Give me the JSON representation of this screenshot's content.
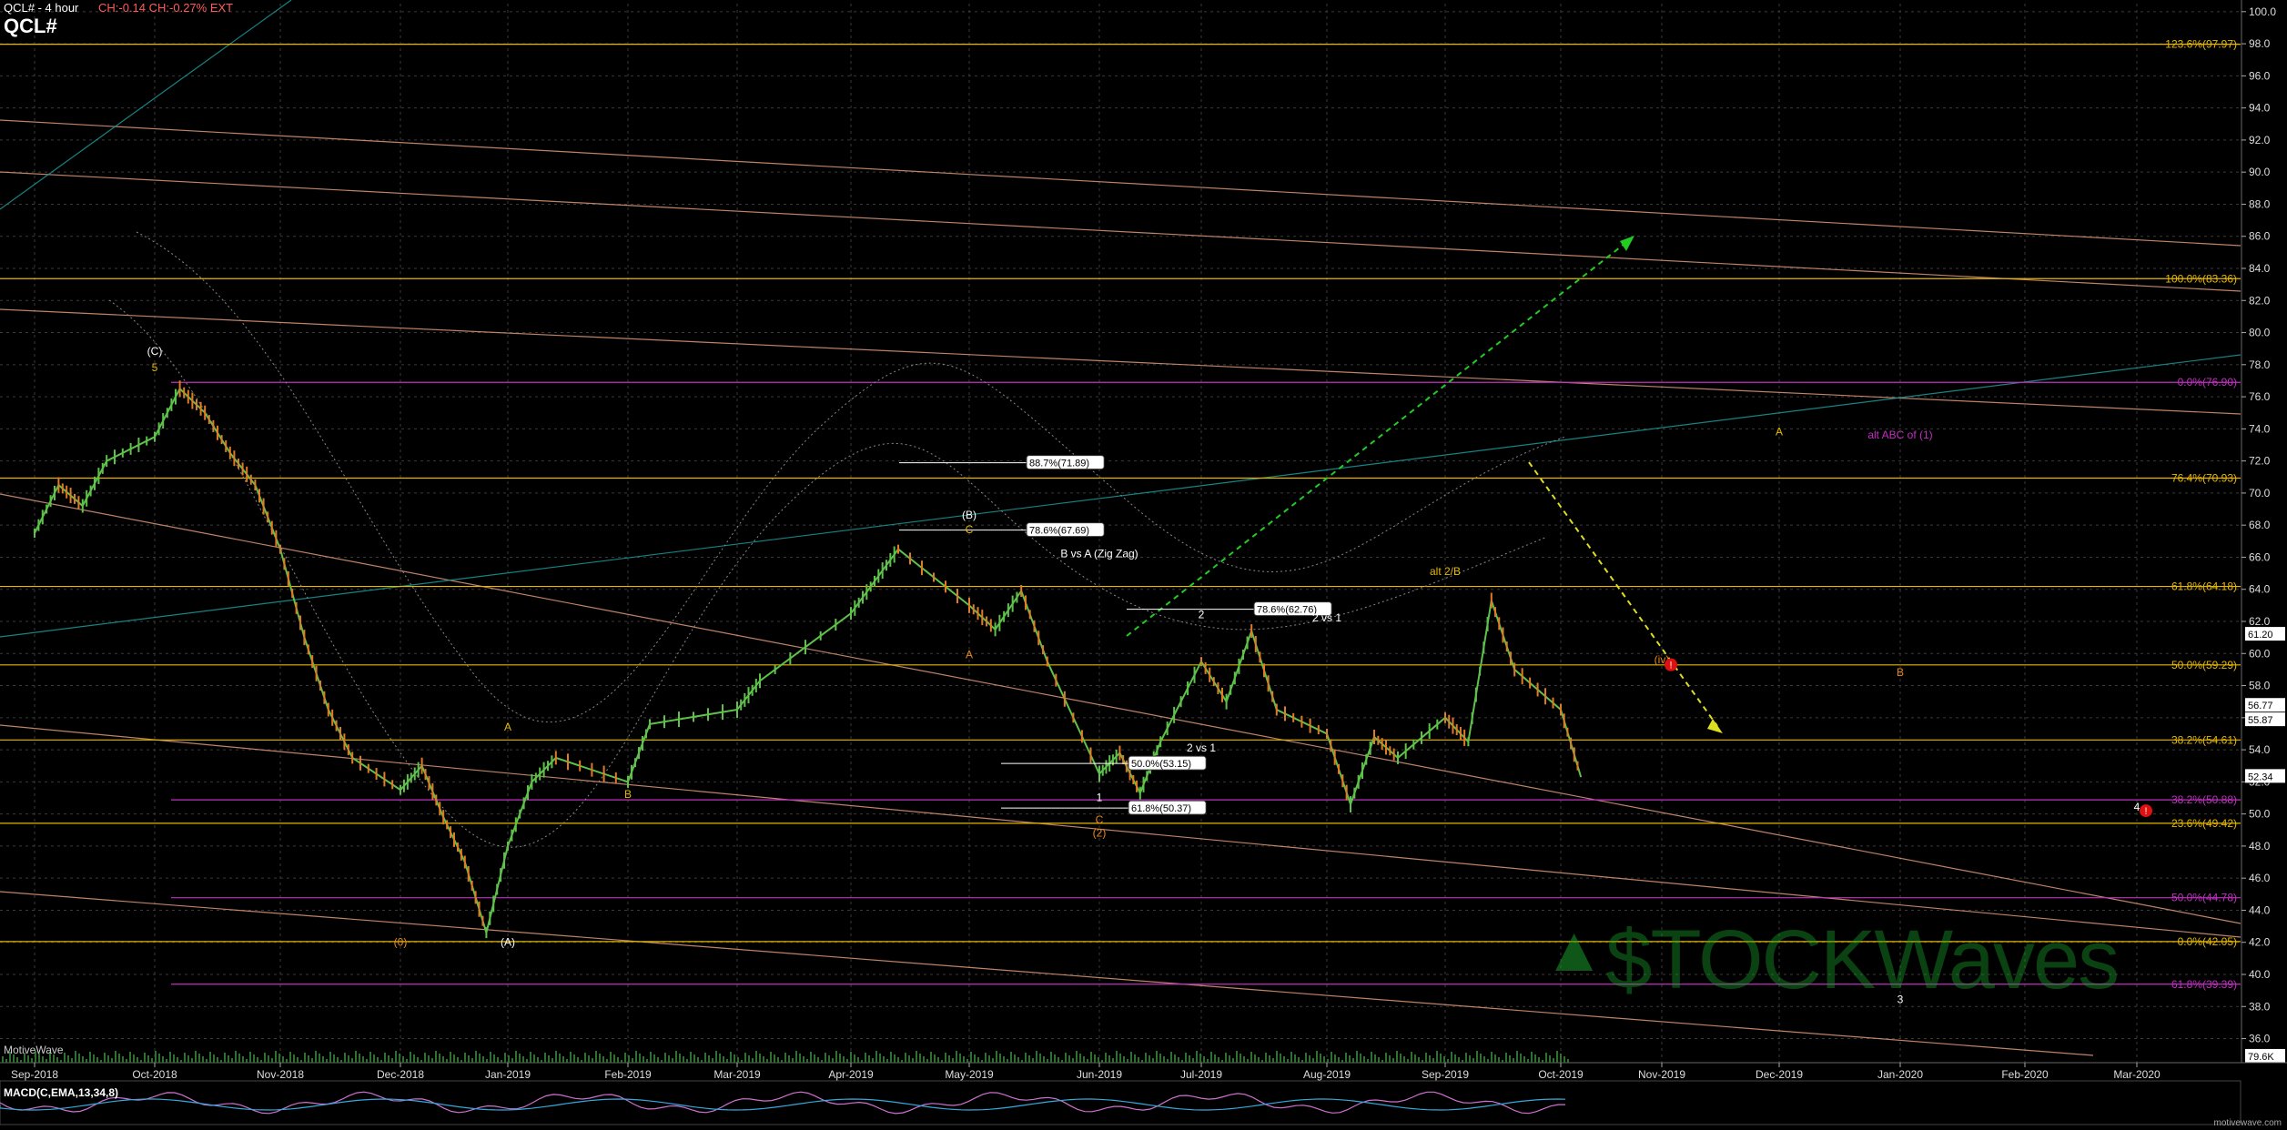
{
  "header": {
    "symbol_line": "QCL# - 4 hour",
    "change": "CH:-0.14 CH:-0.27% EXT",
    "symbol": "QCL#"
  },
  "footer": {
    "motivewave": "MotiveWave",
    "macd": "MACD(C,EMA,13,34,8)",
    "site": "motivewave.com"
  },
  "watermark": {
    "text": "$TOCKWaves",
    "symbol": "▲"
  },
  "colors": {
    "background": "#000000",
    "grid": "#3a3a3a",
    "candle": "#5ec24a",
    "candle_down": "#e07a25",
    "gold": "#e6b800",
    "magenta": "#c030c0",
    "teal": "#1a9a9a",
    "salmon": "#e09a7a",
    "green_arrow": "#22cc22",
    "yellow_arrow": "#dddd22"
  },
  "chart_data": {
    "type": "line",
    "title": "QCL# - 4 hour",
    "x_ticks": [
      "Sep-2018",
      "Oct-2018",
      "Nov-2018",
      "Dec-2018",
      "Jan-2019",
      "Feb-2019",
      "Mar-2019",
      "Apr-2019",
      "May-2019",
      "Jun-2019",
      "Jul-2019",
      "Aug-2019",
      "Sep-2019",
      "Oct-2019",
      "Nov-2019",
      "Dec-2019",
      "Jan-2020",
      "Feb-2020",
      "Mar-2020"
    ],
    "y_ticks": [
      36,
      38,
      40,
      42,
      44,
      46,
      48,
      50,
      52,
      54,
      56,
      58,
      60,
      62,
      64,
      66,
      68,
      70,
      72,
      74,
      76,
      78,
      80,
      82,
      84,
      86,
      88,
      90,
      92,
      94,
      96,
      98,
      100
    ],
    "ylim": [
      34.5,
      100.5
    ],
    "grid": true,
    "price_path": [
      [
        "Sep-2018",
        67.5
      ],
      [
        "Sep-2018b",
        70.5
      ],
      [
        "Sep-2018c",
        69.2
      ],
      [
        "Sep-2018d",
        72.0
      ],
      [
        "Oct-2018",
        73.5
      ],
      [
        "Oct-2018b",
        76.5
      ],
      [
        "Oct-2018c",
        75.0
      ],
      [
        "Oct-2018d",
        72.5
      ],
      [
        "Oct-2018e",
        70.5
      ],
      [
        "Nov-2018",
        66.5
      ],
      [
        "Nov-2018b",
        61.0
      ],
      [
        "Nov-2018c",
        56.5
      ],
      [
        "Nov-2018d",
        53.5
      ],
      [
        "Dec-2018",
        51.5
      ],
      [
        "Dec-2018b",
        53.0
      ],
      [
        "Dec-2018c",
        49.8
      ],
      [
        "Dec-2018d",
        47.0
      ],
      [
        "Dec-2018e",
        42.6
      ],
      [
        "Jan-2019",
        48.0
      ],
      [
        "Jan-2019b",
        52.0
      ],
      [
        "Jan-2019c",
        53.5
      ],
      [
        "Feb-2019",
        52.0
      ],
      [
        "Feb-2019b",
        55.6
      ],
      [
        "Mar-2019",
        56.5
      ],
      [
        "Mar-2019b",
        58.3
      ],
      [
        "Apr-2019",
        62.5
      ],
      [
        "Apr-2019b",
        64.5
      ],
      [
        "Apr-2019c",
        66.5
      ],
      [
        "May-2019",
        63.0
      ],
      [
        "May-2019b",
        61.5
      ],
      [
        "May-2019c",
        63.9
      ],
      [
        "May-2019d",
        59.5
      ],
      [
        "Jun-2019",
        52.5
      ],
      [
        "Jun-2019b",
        53.8
      ],
      [
        "Jun-2019c",
        51.3
      ],
      [
        "Jun-2019d",
        54.5
      ],
      [
        "Jul-2019",
        59.5
      ],
      [
        "Jul-2019b",
        57.0
      ],
      [
        "Jul-2019c",
        61.4
      ],
      [
        "Jul-2019d",
        56.5
      ],
      [
        "Aug-2019",
        55.0
      ],
      [
        "Aug-2019b",
        50.6
      ],
      [
        "Aug-2019c",
        54.8
      ],
      [
        "Aug-2019d",
        53.5
      ],
      [
        "Sep-2019",
        56.0
      ],
      [
        "Sep-2019b",
        54.5
      ],
      [
        "Sep-2019c",
        63.3
      ],
      [
        "Sep-2019d",
        59.0
      ],
      [
        "Oct-2019",
        56.5
      ],
      [
        "Oct-2019b",
        52.3
      ]
    ],
    "price_labels": [
      "100.0",
      "98.0",
      "96.0",
      "94.0",
      "92.0",
      "90.0",
      "88.0",
      "86.0",
      "84.0",
      "82.0",
      "80.0",
      "78.0",
      "76.0",
      "74.0",
      "72.0",
      "70.0",
      "68.0",
      "66.0",
      "64.0",
      "62.0",
      "60.0",
      "58.0",
      "56.0",
      "54.0",
      "52.0",
      "50.0",
      "48.0",
      "46.0",
      "44.0",
      "42.0",
      "40.0",
      "38.0",
      "36.0"
    ],
    "price_boxes": [
      {
        "text": "61.20",
        "y": 61.2
      },
      {
        "text": "56.77",
        "y": 56.77
      },
      {
        "text": "55.87",
        "y": 55.87
      },
      {
        "text": "52.34",
        "y": 52.34
      },
      {
        "text": "79.6K",
        "y": 34.9
      }
    ],
    "fib_levels": [
      {
        "label": "123.6%(97.97)",
        "y": 97.97,
        "color": "gold"
      },
      {
        "label": "100.0%(83.36)",
        "y": 83.36,
        "color": "gold"
      },
      {
        "label": "0.0%(76.90)",
        "y": 76.9,
        "color": "magenta"
      },
      {
        "label": "76.4%(70.93)",
        "y": 70.93,
        "color": "gold"
      },
      {
        "label": "61.8%(64.18)",
        "y": 64.18,
        "color": "gold"
      },
      {
        "label": "50.0%(59.29)",
        "y": 59.29,
        "color": "gold"
      },
      {
        "label": "38.2%(54.61)",
        "y": 54.61,
        "color": "gold"
      },
      {
        "label": "38.2%(50.88)",
        "y": 50.88,
        "color": "magenta"
      },
      {
        "label": "23.6%(49.42)",
        "y": 49.42,
        "color": "gold"
      },
      {
        "label": "50.0%(44.78)",
        "y": 44.78,
        "color": "magenta"
      },
      {
        "label": "0.0%(42.05)",
        "y": 42.05,
        "color": "gold"
      },
      {
        "label": "61.8%(39.39)",
        "y": 39.39,
        "color": "magenta"
      }
    ],
    "ret_boxes": [
      {
        "text": "88.7%(71.89)",
        "date": "Jun-2019",
        "y": 71.89
      },
      {
        "text": "78.6%(67.69)",
        "date": "Jun-2019",
        "y": 67.69
      },
      {
        "text": "78.6%(62.76)",
        "date": "Aug-2019",
        "y": 62.76
      },
      {
        "text": "50.0%(53.15)",
        "date": "Jul-2019",
        "y": 53.15
      },
      {
        "text": "61.8%(50.37)",
        "date": "Jul-2019",
        "y": 50.37
      }
    ],
    "wave_labels": [
      {
        "text": "(C)",
        "date": "Oct-2018",
        "y": 78.6,
        "color": "white"
      },
      {
        "text": "5",
        "date": "Oct-2018",
        "y": 77.6,
        "color": "gold"
      },
      {
        "text": "(0)",
        "date": "Dec-2018",
        "y": 41.8,
        "color": "orange"
      },
      {
        "text": "(A)",
        "date": "Jan-2019",
        "y": 41.8,
        "color": "white"
      },
      {
        "text": "A",
        "date": "Jan-2019",
        "y": 55.2,
        "color": "gold"
      },
      {
        "text": "B",
        "date": "Feb-2019",
        "y": 51.0,
        "color": "gold"
      },
      {
        "text": "(B)",
        "date": "May-2019",
        "y": 68.4,
        "color": "white"
      },
      {
        "text": "C",
        "date": "May-2019",
        "y": 67.5,
        "color": "gold"
      },
      {
        "text": "B vs A (Zig Zag)",
        "date": "Jun-2019",
        "y": 66.0,
        "color": "white"
      },
      {
        "text": "A",
        "date": "May-2019",
        "y": 59.7,
        "color": "orange"
      },
      {
        "text": "1",
        "date": "Jun-2019",
        "y": 50.8,
        "color": "white"
      },
      {
        "text": "C",
        "date": "Jun-2019",
        "y": 49.4,
        "color": "orange"
      },
      {
        "text": "(2)",
        "date": "Jun-2019",
        "y": 48.6,
        "color": "orange"
      },
      {
        "text": "2",
        "date": "Jul-2019",
        "y": 62.2,
        "color": "white"
      },
      {
        "text": "2 vs 1",
        "date": "Aug-2019",
        "y": 62.0,
        "color": "white"
      },
      {
        "text": "2 vs 1",
        "date": "Jul-2019",
        "y": 53.9,
        "color": "white"
      },
      {
        "text": "alt 2/B",
        "date": "Sep-2019",
        "y": 64.9,
        "color": "gold"
      },
      {
        "text": "A",
        "date": "Dec-2019",
        "y": 73.6,
        "color": "gold"
      },
      {
        "text": "alt ABC of (1)",
        "date": "Jan-2020",
        "y": 73.4,
        "color": "magenta"
      },
      {
        "text": "(iv)",
        "date": "Nov-2019",
        "y": 59.4,
        "color": "orange"
      },
      {
        "text": "B",
        "date": "Jan-2020",
        "y": 58.6,
        "color": "orange"
      },
      {
        "text": "4",
        "date": "Mar-2020",
        "y": 50.2,
        "color": "white"
      },
      {
        "text": "3",
        "date": "Jan-2020",
        "y": 38.2,
        "color": "white"
      }
    ],
    "alerts": [
      {
        "date": "Nov-2019",
        "y": 59.3
      },
      {
        "date": "Mar-2020",
        "y": 50.2
      }
    ]
  }
}
